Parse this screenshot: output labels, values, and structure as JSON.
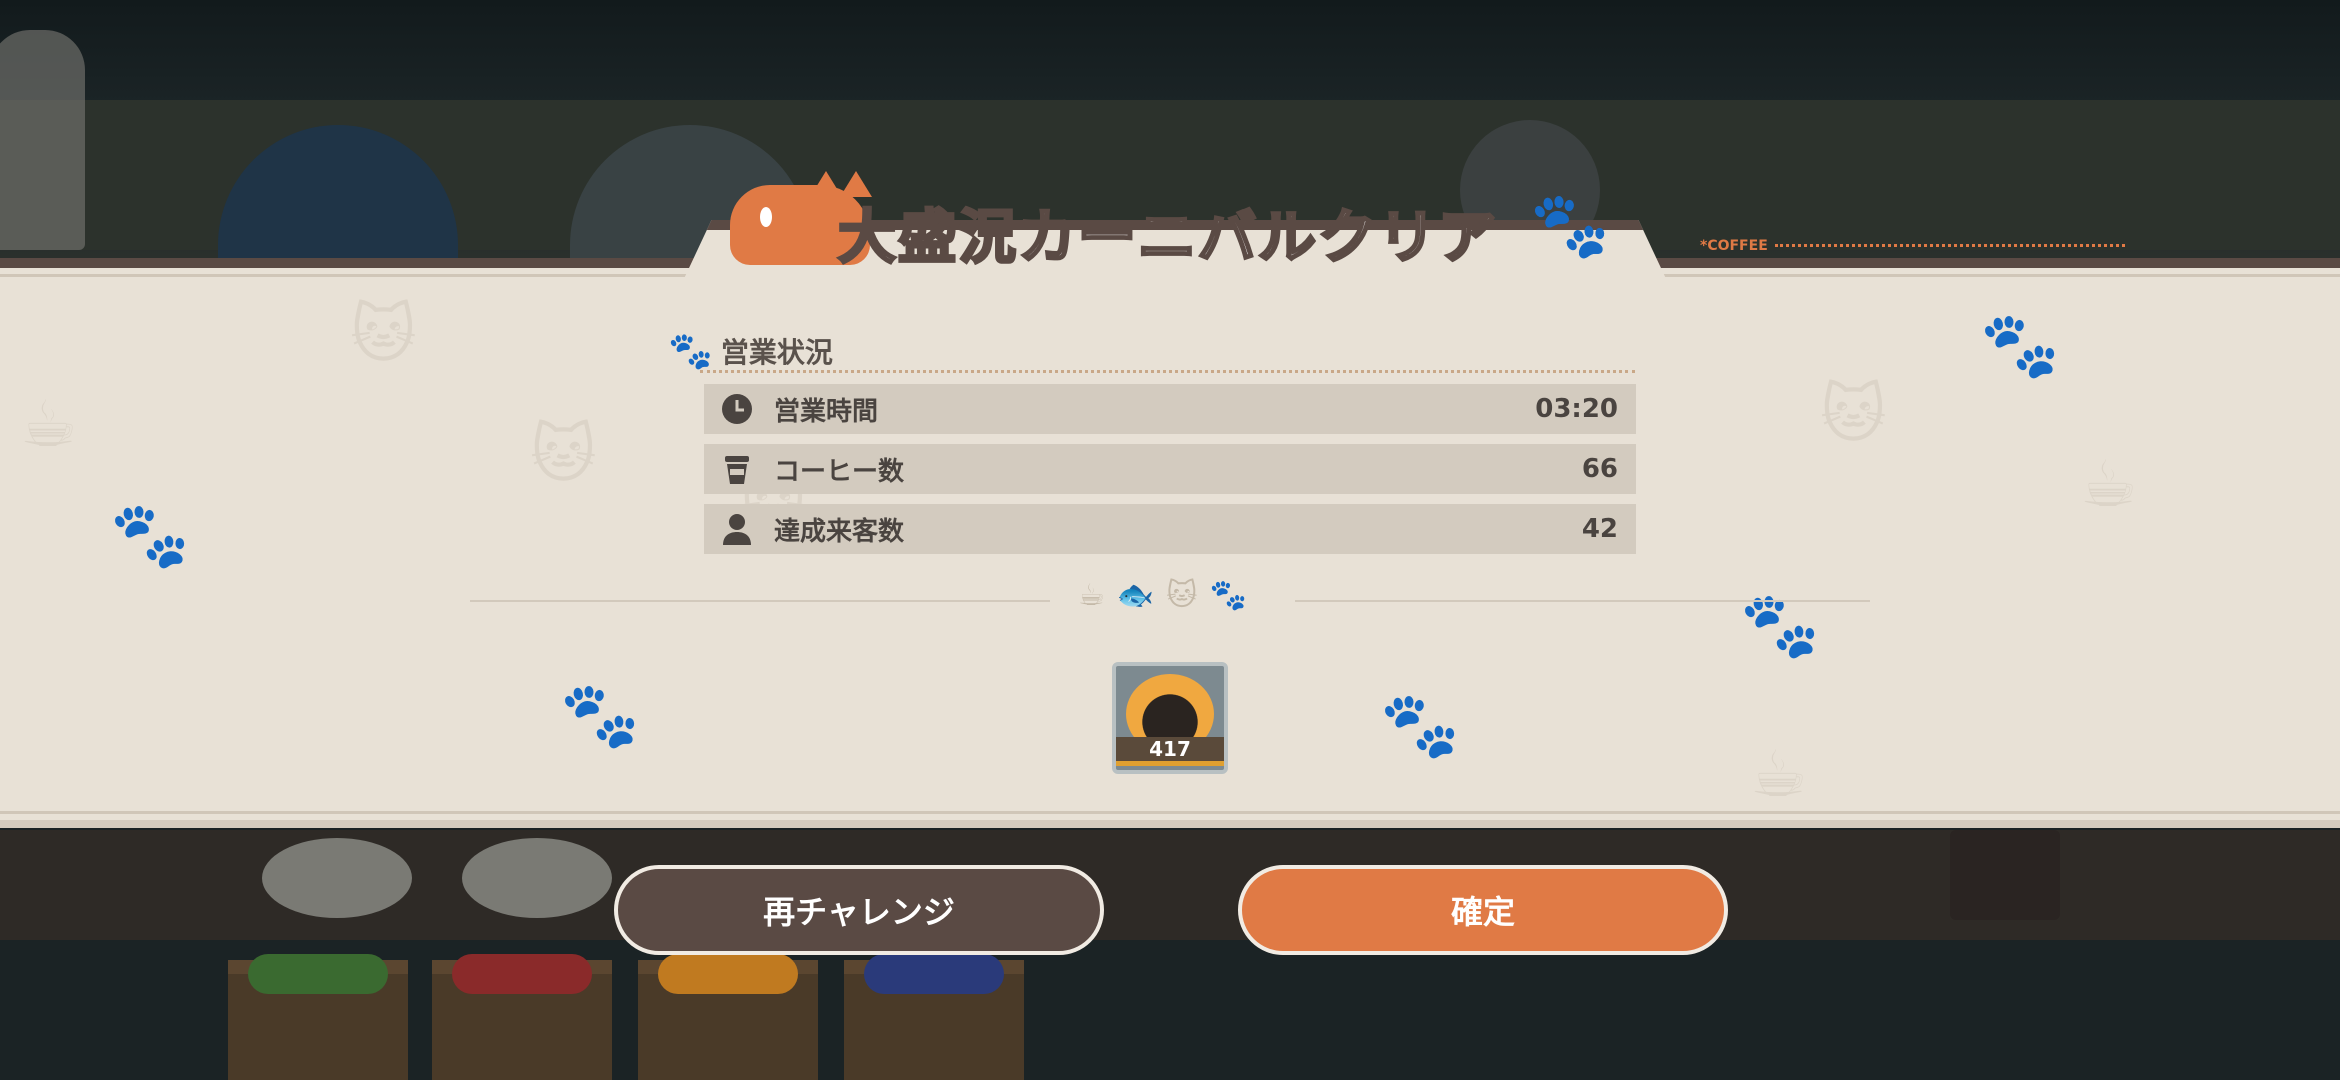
{
  "header": {
    "title": "大盛況カーニバルクリア",
    "tag": "*COFFEE"
  },
  "section": {
    "title": "営業状況"
  },
  "stats": [
    {
      "icon": "clock-icon",
      "label": "営業時間",
      "value": "03:20"
    },
    {
      "icon": "cup-icon",
      "label": "コーヒー数",
      "value": "66"
    },
    {
      "icon": "person-icon",
      "label": "達成来客数",
      "value": "42"
    }
  ],
  "reward": {
    "icon": "cat-coin-icon",
    "count": "417"
  },
  "buttons": {
    "retry": "再チャレンジ",
    "confirm": "確定"
  },
  "colors": {
    "accent": "#e07a45",
    "dark": "#5a4a44",
    "panel": "#e8e1d6"
  }
}
